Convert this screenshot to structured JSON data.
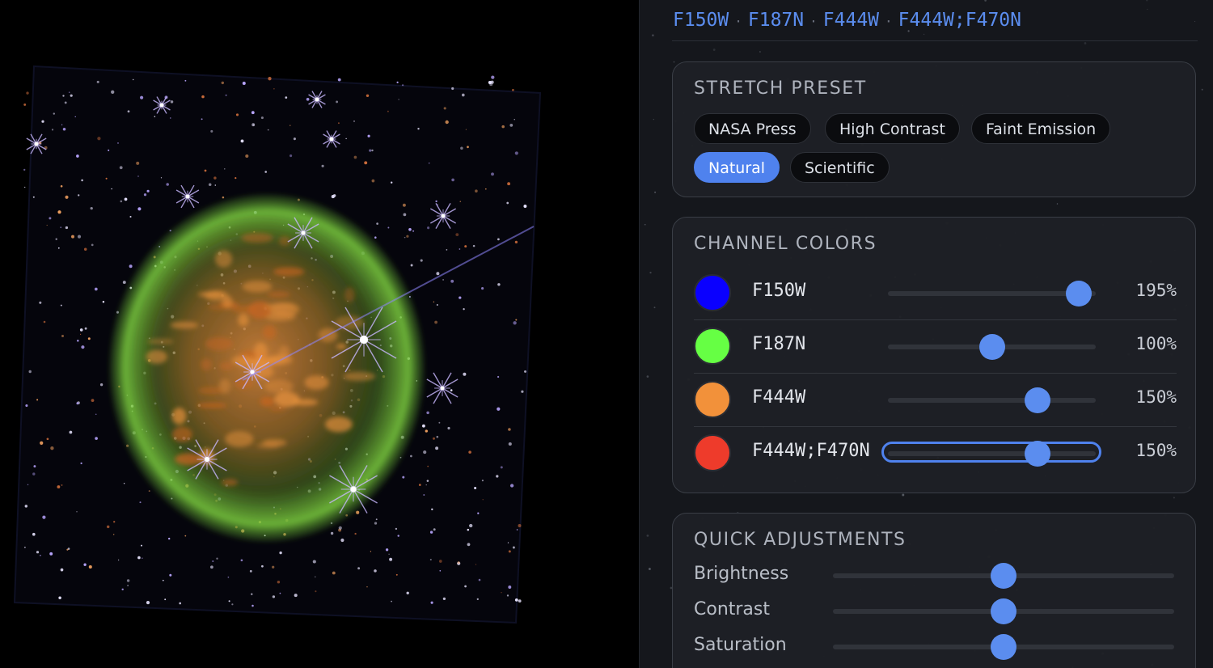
{
  "filters": [
    "F150W",
    "F187N",
    "F444W",
    "F444W;F470N"
  ],
  "stretch": {
    "title": "STRETCH PRESET",
    "presets": [
      "NASA Press",
      "High Contrast",
      "Faint Emission",
      "Natural",
      "Scientific"
    ],
    "active": "Natural"
  },
  "channels": {
    "title": "CHANNEL COLORS",
    "items": [
      {
        "name": "F150W",
        "color": "#0a00ff",
        "value": "195%",
        "level": 0.92
      },
      {
        "name": "F187N",
        "color": "#66ff44",
        "value": "100%",
        "level": 0.5
      },
      {
        "name": "F444W",
        "color": "#f2913a",
        "value": "150%",
        "level": 0.72
      },
      {
        "name": "F444W;F470N",
        "color": "#ee3b2b",
        "value": "150%",
        "level": 0.72
      }
    ]
  },
  "quick": {
    "title": "QUICK ADJUSTMENTS",
    "items": [
      {
        "label": "Brightness",
        "level": 0.5
      },
      {
        "label": "Contrast",
        "level": 0.5
      },
      {
        "label": "Saturation",
        "level": 0.5
      }
    ]
  },
  "colors": {
    "accent": "#4f82ee",
    "nebula_shell": "#6fbf3a",
    "nebula_core": "#d9883a"
  }
}
